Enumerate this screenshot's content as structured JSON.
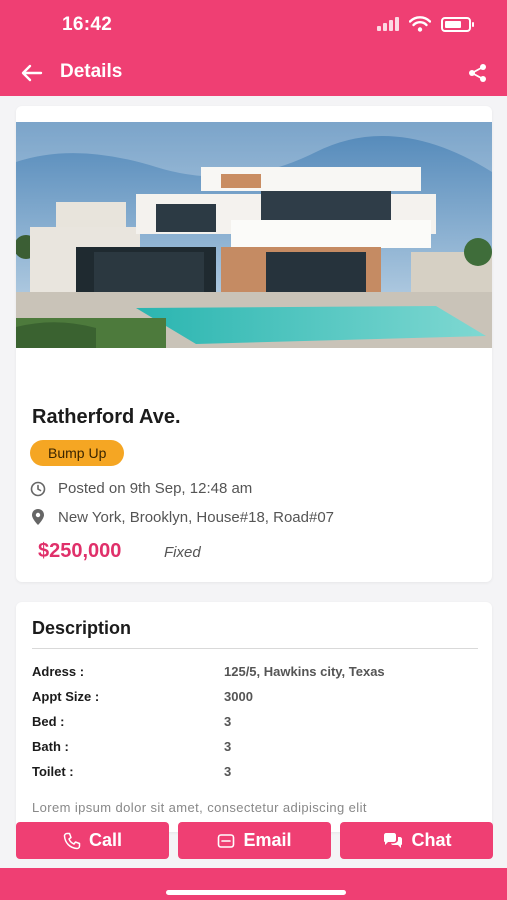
{
  "status_bar": {
    "time": "16:42"
  },
  "app_bar": {
    "title": "Details"
  },
  "listing": {
    "title": "Ratherford Ave.",
    "badge": "Bump Up",
    "posted": "Posted on 9th Sep, 12:48 am",
    "location": "New York, Brooklyn, House#18, Road#07",
    "price": "$250,000",
    "price_type": "Fixed"
  },
  "description": {
    "heading": "Description",
    "specs": [
      {
        "label": "Adress :",
        "value": "125/5, Hawkins city, Texas"
      },
      {
        "label": "Appt Size :",
        "value": "3000"
      },
      {
        "label": "Bed  :",
        "value": "3"
      },
      {
        "label": "Bath :",
        "value": "3"
      },
      {
        "label": "Toilet :",
        "value": "3"
      }
    ],
    "body": "Lorem ipsum dolor sit amet, consectetur adipiscing elit"
  },
  "actions": {
    "call": "Call",
    "email": "Email",
    "chat": "Chat"
  },
  "icons": {
    "back": "arrow-left-icon",
    "share": "share-icon",
    "clock": "clock-icon",
    "location": "map-pin-icon",
    "phone": "phone-icon",
    "mail": "mail-icon",
    "chat": "chat-bubbles-icon"
  },
  "colors": {
    "primary": "#ef3f73",
    "badge": "#f5a623",
    "price": "#e0306a"
  }
}
